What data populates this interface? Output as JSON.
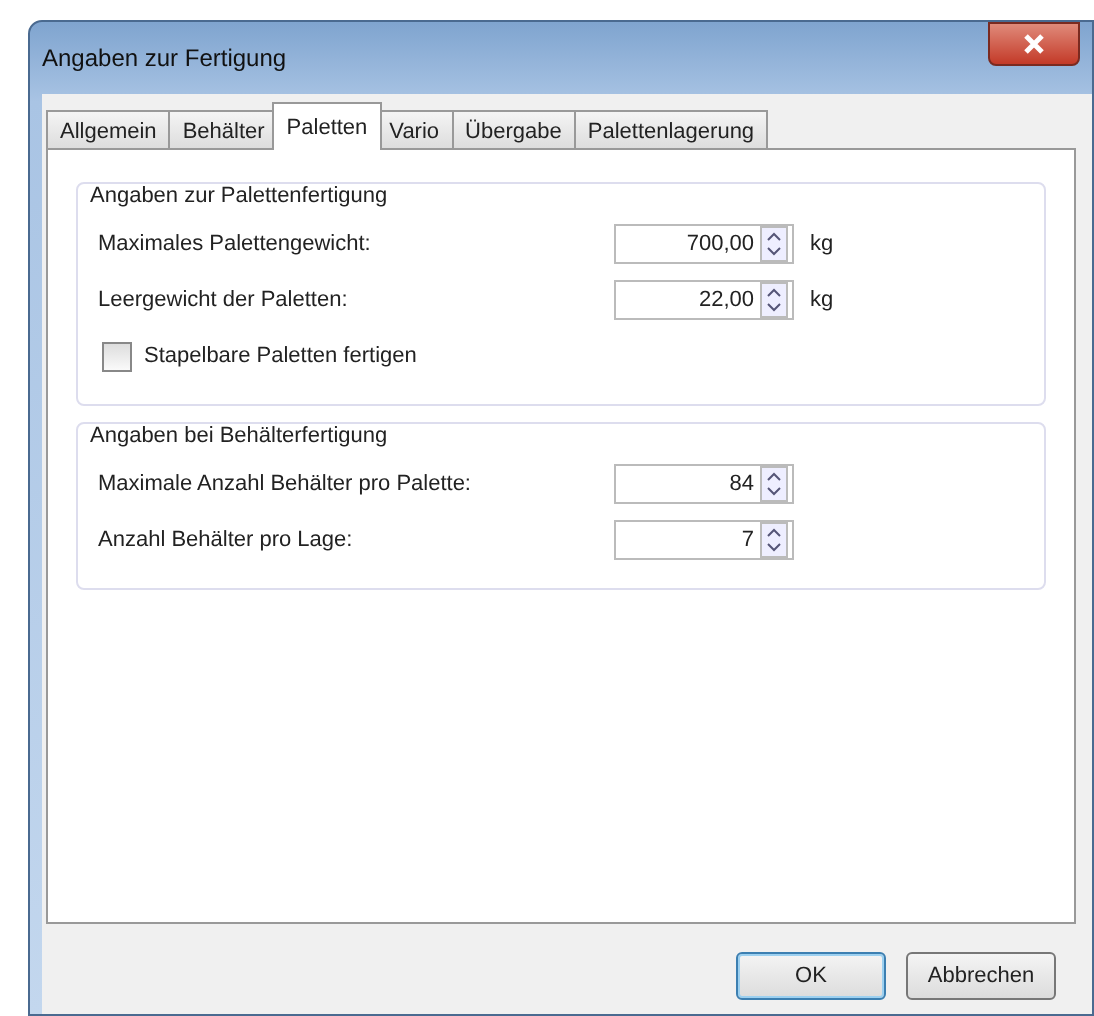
{
  "window": {
    "title": "Angaben zur Fertigung"
  },
  "tabs": [
    {
      "label": "Allgemein",
      "selected": false
    },
    {
      "label": "Behälter",
      "selected": false
    },
    {
      "label": "Paletten",
      "selected": true
    },
    {
      "label": "Vario",
      "selected": false
    },
    {
      "label": "Übergabe",
      "selected": false
    },
    {
      "label": "Palettenlagerung",
      "selected": false
    }
  ],
  "groups": [
    {
      "title": "Angaben zur Palettenfertigung",
      "rows": [
        {
          "kind": "spinner",
          "label": "Maximales Palettengewicht:",
          "value": "700,00",
          "unit": "kg"
        },
        {
          "kind": "spinner",
          "label": "Leergewicht der Paletten:",
          "value": "22,00",
          "unit": "kg"
        },
        {
          "kind": "checkbox",
          "label": "Stapelbare Paletten fertigen",
          "checked": false
        }
      ]
    },
    {
      "title": "Angaben bei Behälterfertigung",
      "rows": [
        {
          "kind": "spinner",
          "label": "Maximale Anzahl Behälter pro Palette:",
          "value": "84"
        },
        {
          "kind": "spinner",
          "label": "Anzahl Behälter pro Lage:",
          "value": "7"
        }
      ]
    }
  ],
  "buttons": [
    {
      "label": "OK",
      "default": true
    },
    {
      "label": "Abbrechen",
      "default": false
    }
  ]
}
